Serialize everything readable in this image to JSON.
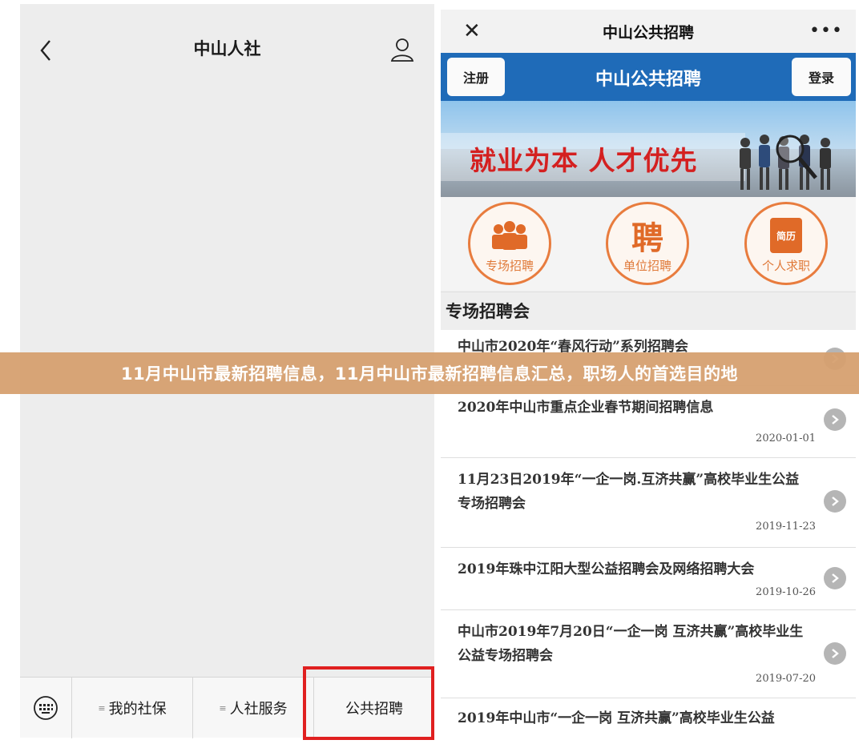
{
  "left_phone": {
    "title": "中山人社",
    "menu": [
      {
        "label": "我的社保",
        "has_submenu": true
      },
      {
        "label": "人社服务",
        "has_submenu": true
      },
      {
        "label": "公共招聘",
        "has_submenu": false
      }
    ],
    "highlight_color": "#e02020"
  },
  "right_phone": {
    "nav": {
      "close_symbol": "✕",
      "title": "中山公共招聘",
      "more_symbol": "•••"
    },
    "header": {
      "register_label": "注册",
      "title": "中山公共招聘",
      "login_label": "登录",
      "color": "#1f6bb8"
    },
    "banner": {
      "slogan": "就业为本  人才优先"
    },
    "quick_links": [
      {
        "label": "专场招聘",
        "icon": "group-icon"
      },
      {
        "label": "单位招聘",
        "icon": "recruit-icon",
        "glyph": "聘"
      },
      {
        "label": "个人求职",
        "icon": "resume-icon",
        "glyph": "简历"
      }
    ],
    "section_title": "专场招聘会",
    "items": [
      {
        "title": "中山市2020年“春风行动”系列招聘会",
        "date": ""
      },
      {
        "title": "2020年中山市重点企业春节期间招聘信息",
        "date": "2020-01-01"
      },
      {
        "title": "11月23日2019年“一企一岗.互济共赢”高校毕业生公益专场招聘会",
        "date": "2019-11-23"
      },
      {
        "title": "2019年珠中江阳大型公益招聘会及网络招聘大会",
        "date": "2019-10-26"
      },
      {
        "title": "中山市2019年7月20日“一企一岗 互济共赢”高校毕业生公益专场招聘会",
        "date": "2019-07-20"
      },
      {
        "title": "2019年中山市“一企一岗 互济共赢”高校毕业生公益",
        "date": ""
      }
    ]
  },
  "caption": "11月中山市最新招聘信息，11月中山市最新招聘信息汇总，职场人的首选目的地"
}
